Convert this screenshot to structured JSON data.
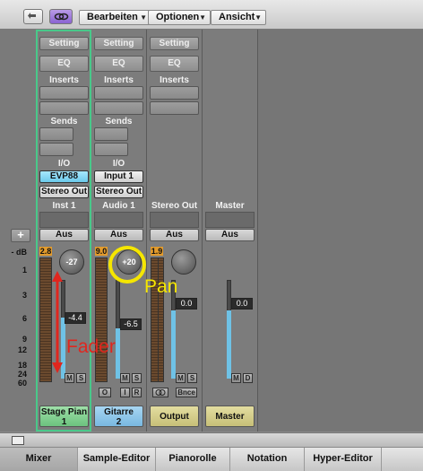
{
  "toolbar": {
    "menus": [
      "Bearbeiten",
      "Optionen",
      "Ansicht"
    ]
  },
  "add_button": "+",
  "db_scale": [
    "- dB",
    "1",
    "3",
    "6",
    "9",
    "12",
    "18",
    "24",
    "60"
  ],
  "strips": {
    "inst1": {
      "setting": "Setting",
      "eq": "EQ",
      "inserts": "Inserts",
      "sends": "Sends",
      "io": "I/O",
      "input": "EVP88",
      "output": "Stereo Out",
      "name": "Inst 1",
      "auto": "Aus",
      "peak": "2.8",
      "pan": "-27",
      "volume": "-4.4",
      "m": "M",
      "s": "S",
      "channel_name_line1": "Stage Pian",
      "channel_name_line2": "1"
    },
    "audio1": {
      "setting": "Setting",
      "eq": "EQ",
      "inserts": "Inserts",
      "sends": "Sends",
      "io": "I/O",
      "input": "Input 1",
      "output": "Stereo Out",
      "name": "Audio 1",
      "auto": "Aus",
      "peak": "9.0",
      "pan": "+20",
      "volume": "-6.5",
      "m": "M",
      "s": "S",
      "o": "O",
      "i": "I",
      "r": "R",
      "channel_name_line1": "Gitarre",
      "channel_name_line2": "2"
    },
    "stereo_out": {
      "setting": "Setting",
      "eq": "EQ",
      "inserts": "Inserts",
      "name": "Stereo Out",
      "auto": "Aus",
      "peak": "1.9",
      "volume": "0.0",
      "m": "M",
      "s": "S",
      "bnce": "Bnce",
      "channel_name": "Output"
    },
    "master": {
      "name": "Master",
      "auto": "Aus",
      "volume": "0.0",
      "m": "M",
      "d": "D",
      "channel_name": "Master"
    }
  },
  "annotations": {
    "fader": "Fader",
    "pan": "Pan"
  },
  "tabs": [
    "Mixer",
    "Sample-Editor",
    "Pianorolle",
    "Notation",
    "Hyper-Editor"
  ],
  "fader_levels": {
    "inst1": 0.62,
    "audio1": 0.55,
    "stereo_out": 0.66,
    "master": 0.66
  },
  "colors": {
    "selected_outline": "#49c98a",
    "pan_highlight": "#f5e600",
    "fader_arrow": "#e0261e",
    "fader_fill": "#6fc2e6"
  }
}
